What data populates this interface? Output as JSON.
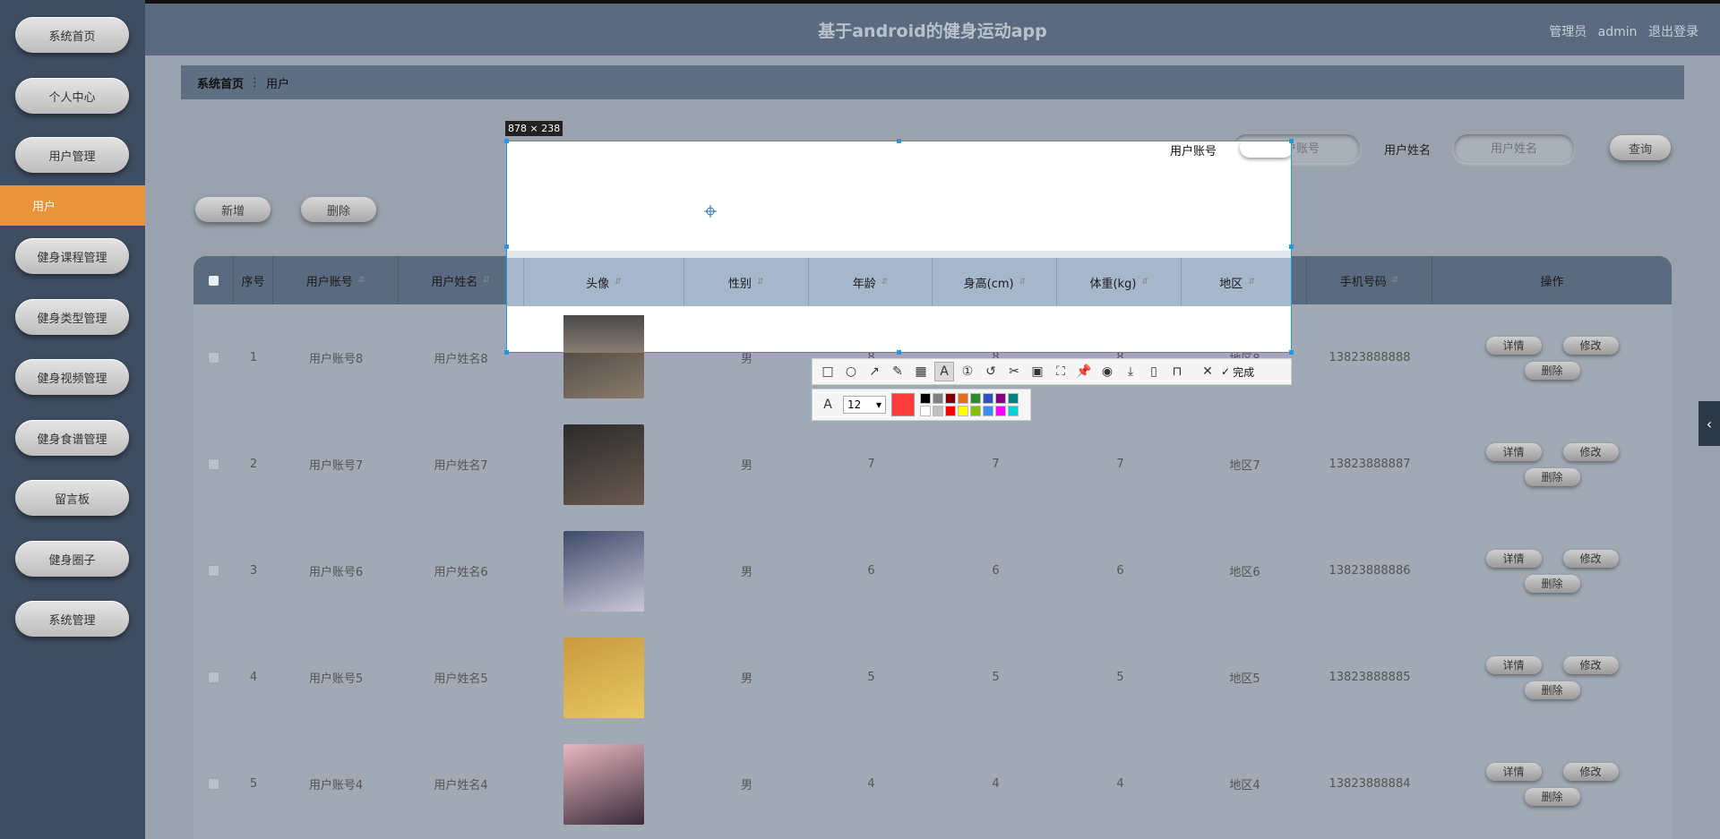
{
  "sidebar": {
    "items": [
      {
        "label": "系统首页"
      },
      {
        "label": "个人中心"
      },
      {
        "label": "用户管理"
      },
      {
        "label": "用户"
      },
      {
        "label": "健身课程管理"
      },
      {
        "label": "健身类型管理"
      },
      {
        "label": "健身视频管理"
      },
      {
        "label": "健身食谱管理"
      },
      {
        "label": "留言板"
      },
      {
        "label": "健身圈子"
      },
      {
        "label": "系统管理"
      }
    ]
  },
  "header": {
    "title": "基于android的健身运动app",
    "role": "管理员",
    "username": "admin",
    "logout": "退出登录"
  },
  "breadcrumb": {
    "home": "系统首页",
    "current": "用户"
  },
  "search": {
    "account_label": "用户账号",
    "account_placeholder": "用户账号",
    "name_label": "用户姓名",
    "name_placeholder": "用户姓名",
    "query_button": "查询"
  },
  "actions": {
    "add": "新增",
    "delete": "删除"
  },
  "table": {
    "columns": [
      "序号",
      "用户账号",
      "用户姓名",
      "头像",
      "性别",
      "年龄",
      "身高(cm)",
      "体重(kg)",
      "地区",
      "手机号码",
      "操作"
    ],
    "rows": [
      {
        "index": "1",
        "account": "用户账号8",
        "name": "用户姓名8",
        "gender": "男",
        "age": "8",
        "height": "8",
        "weight": "8",
        "region": "地区8",
        "phone": "13823888888"
      },
      {
        "index": "2",
        "account": "用户账号7",
        "name": "用户姓名7",
        "gender": "男",
        "age": "7",
        "height": "7",
        "weight": "7",
        "region": "地区7",
        "phone": "13823888887"
      },
      {
        "index": "3",
        "account": "用户账号6",
        "name": "用户姓名6",
        "gender": "男",
        "age": "6",
        "height": "6",
        "weight": "6",
        "region": "地区6",
        "phone": "13823888886"
      },
      {
        "index": "4",
        "account": "用户账号5",
        "name": "用户姓名5",
        "gender": "男",
        "age": "5",
        "height": "5",
        "weight": "5",
        "region": "地区5",
        "phone": "13823888885"
      },
      {
        "index": "5",
        "account": "用户账号4",
        "name": "用户姓名4",
        "gender": "男",
        "age": "4",
        "height": "4",
        "weight": "4",
        "region": "地区4",
        "phone": "13823888884"
      }
    ],
    "row_buttons": {
      "detail": "详情",
      "edit": "修改",
      "delete": "删除"
    }
  },
  "capture": {
    "size_label": "878 × 238",
    "font_size": "12",
    "done_label": "完成",
    "current_color": "#ff3b3b",
    "palette": [
      "#000000",
      "#808080",
      "#800000",
      "#e07020",
      "#2e8b2e",
      "#3050c0",
      "#800080",
      "#008080",
      "#ffffff",
      "#c0c0c0",
      "#ff0000",
      "#ffff00",
      "#80c000",
      "#3a8ef0",
      "#ff00ff",
      "#00d0d0"
    ],
    "tools": [
      "rectangle-icon",
      "ellipse-icon",
      "arrow-icon",
      "pencil-icon",
      "mosaic-icon",
      "text-icon",
      "number-icon",
      "undo-icon",
      "cut-icon",
      "ocr-icon",
      "scroll-capture-icon",
      "pin-icon",
      "record-icon",
      "download-icon",
      "copy-icon",
      "bookmark-icon"
    ]
  },
  "colors": {
    "accent": "#e8953a",
    "selection": "#1e9be6"
  }
}
